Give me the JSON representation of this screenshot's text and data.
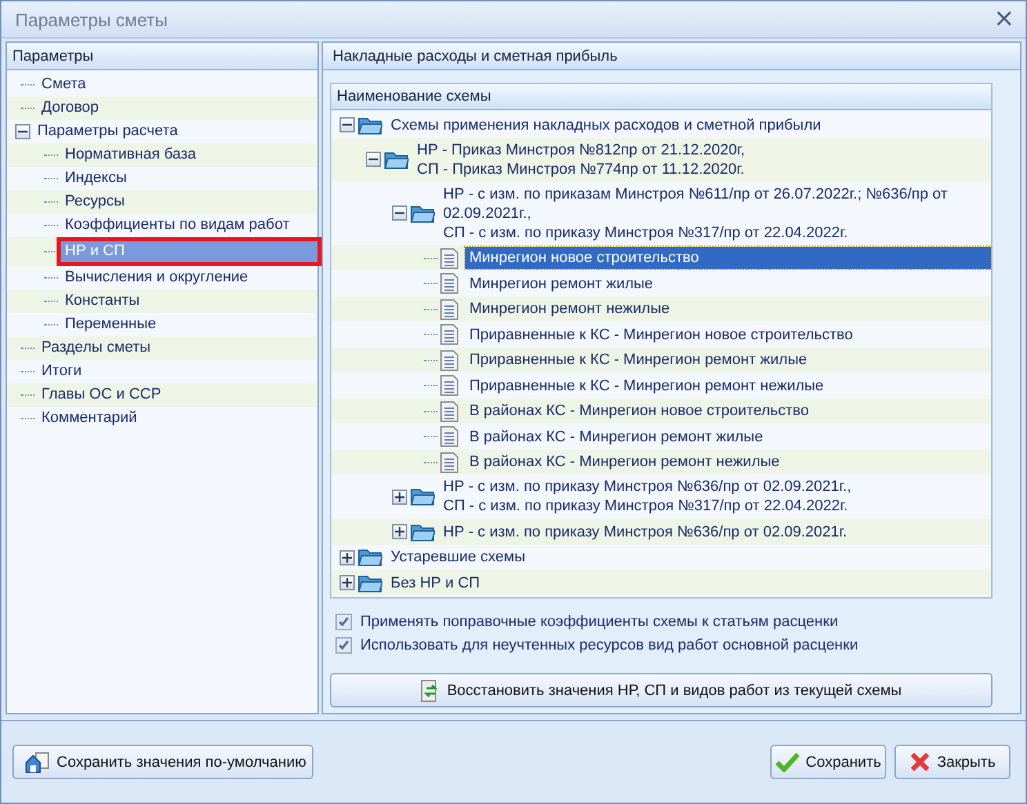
{
  "window": {
    "title": "Параметры сметы",
    "close": "×"
  },
  "sidebar": {
    "title": "Параметры",
    "items": [
      {
        "label": "Смета",
        "selected": false,
        "annotated": false
      },
      {
        "label": "Договор",
        "selected": false,
        "annotated": false
      },
      {
        "label": "Параметры расчета",
        "selected": false,
        "annotated": false,
        "expanded": true,
        "children": [
          {
            "label": "Нормативная база",
            "selected": false,
            "annotated": false
          },
          {
            "label": "Индексы",
            "selected": false,
            "annotated": false
          },
          {
            "label": "Ресурсы",
            "selected": false,
            "annotated": false
          },
          {
            "label": "Коэффициенты по видам работ",
            "selected": false,
            "annotated": false
          },
          {
            "label": "НР и СП",
            "selected": true,
            "annotated": true
          },
          {
            "label": "Вычисления и округление",
            "selected": false,
            "annotated": false
          },
          {
            "label": "Константы",
            "selected": false,
            "annotated": false
          },
          {
            "label": "Переменные",
            "selected": false,
            "annotated": false
          }
        ]
      },
      {
        "label": "Разделы сметы",
        "selected": false,
        "annotated": false
      },
      {
        "label": "Итоги",
        "selected": false,
        "annotated": false
      },
      {
        "label": "Главы ОС и ССР",
        "selected": false,
        "annotated": false
      },
      {
        "label": "Комментарий",
        "selected": false,
        "annotated": false
      }
    ]
  },
  "panel": {
    "title": "Накладные расходы и сметная прибыль",
    "tree": {
      "column": "Наименование схемы",
      "items": [
        {
          "kind": "folder",
          "label": "Схемы применения накладных расходов и сметной прибыли",
          "expanded": true,
          "selected": false,
          "children": [
            {
              "kind": "folder",
              "label": "НР - Приказ Минстроя №812пр от 21.12.2020г,\nСП - Приказ Минстроя №774пр от 11.12.2020г.",
              "expanded": true,
              "selected": false,
              "children": [
                {
                  "kind": "folder",
                  "label": "НР - с изм. по приказам Минстроя №611/пр от 26.07.2022г.; №636/пр от\n02.09.2021г.,\nСП - с изм. по приказу Минстроя №317/пр от 22.04.2022г.",
                  "expanded": true,
                  "selected": false,
                  "children": [
                    {
                      "kind": "scheme",
                      "label": "Минрегион новое строительство",
                      "selected": true
                    },
                    {
                      "kind": "scheme",
                      "label": "Минрегион ремонт жилые",
                      "selected": false
                    },
                    {
                      "kind": "scheme",
                      "label": "Минрегион ремонт нежилые",
                      "selected": false
                    },
                    {
                      "kind": "scheme",
                      "label": "Приравненные к КС - Минрегион новое строительство",
                      "selected": false
                    },
                    {
                      "kind": "scheme",
                      "label": "Приравненные к КС - Минрегион ремонт жилые",
                      "selected": false
                    },
                    {
                      "kind": "scheme",
                      "label": "Приравненные к КС - Минрегион ремонт нежилые",
                      "selected": false
                    },
                    {
                      "kind": "scheme",
                      "label": "В районах КС - Минрегион новое строительство",
                      "selected": false
                    },
                    {
                      "kind": "scheme",
                      "label": "В районах КС - Минрегион ремонт жилые",
                      "selected": false
                    },
                    {
                      "kind": "scheme",
                      "label": "В районах КС - Минрегион ремонт нежилые",
                      "selected": false
                    }
                  ]
                },
                {
                  "kind": "folder",
                  "label": "НР - с изм. по приказу Минстроя №636/пр от 02.09.2021г.,\nСП - с изм. по приказу Минстроя №317/пр от 22.04.2022г.",
                  "expanded": false,
                  "selected": false
                },
                {
                  "kind": "folder",
                  "label": "НР - с изм. по приказу Минстроя №636/пр от 02.09.2021г.",
                  "expanded": false,
                  "selected": false
                }
              ]
            }
          ]
        },
        {
          "kind": "folder",
          "label": "Устаревшие схемы",
          "expanded": false,
          "selected": false
        },
        {
          "kind": "folder",
          "label": "Без НР и СП",
          "expanded": false,
          "selected": false
        }
      ]
    },
    "options": [
      {
        "label": "Применять поправочные коэффициенты схемы к статьям расценки",
        "checked": true
      },
      {
        "label": "Использовать для неучтенных ресурсов вид работ основной расценки",
        "checked": true
      }
    ],
    "restore_button": "Восстановить значения НР, СП и видов работ из текущей схемы"
  },
  "footer": {
    "save_default": "Сохранить значения по-умолчанию",
    "save": "Сохранить",
    "close": "Закрыть"
  }
}
